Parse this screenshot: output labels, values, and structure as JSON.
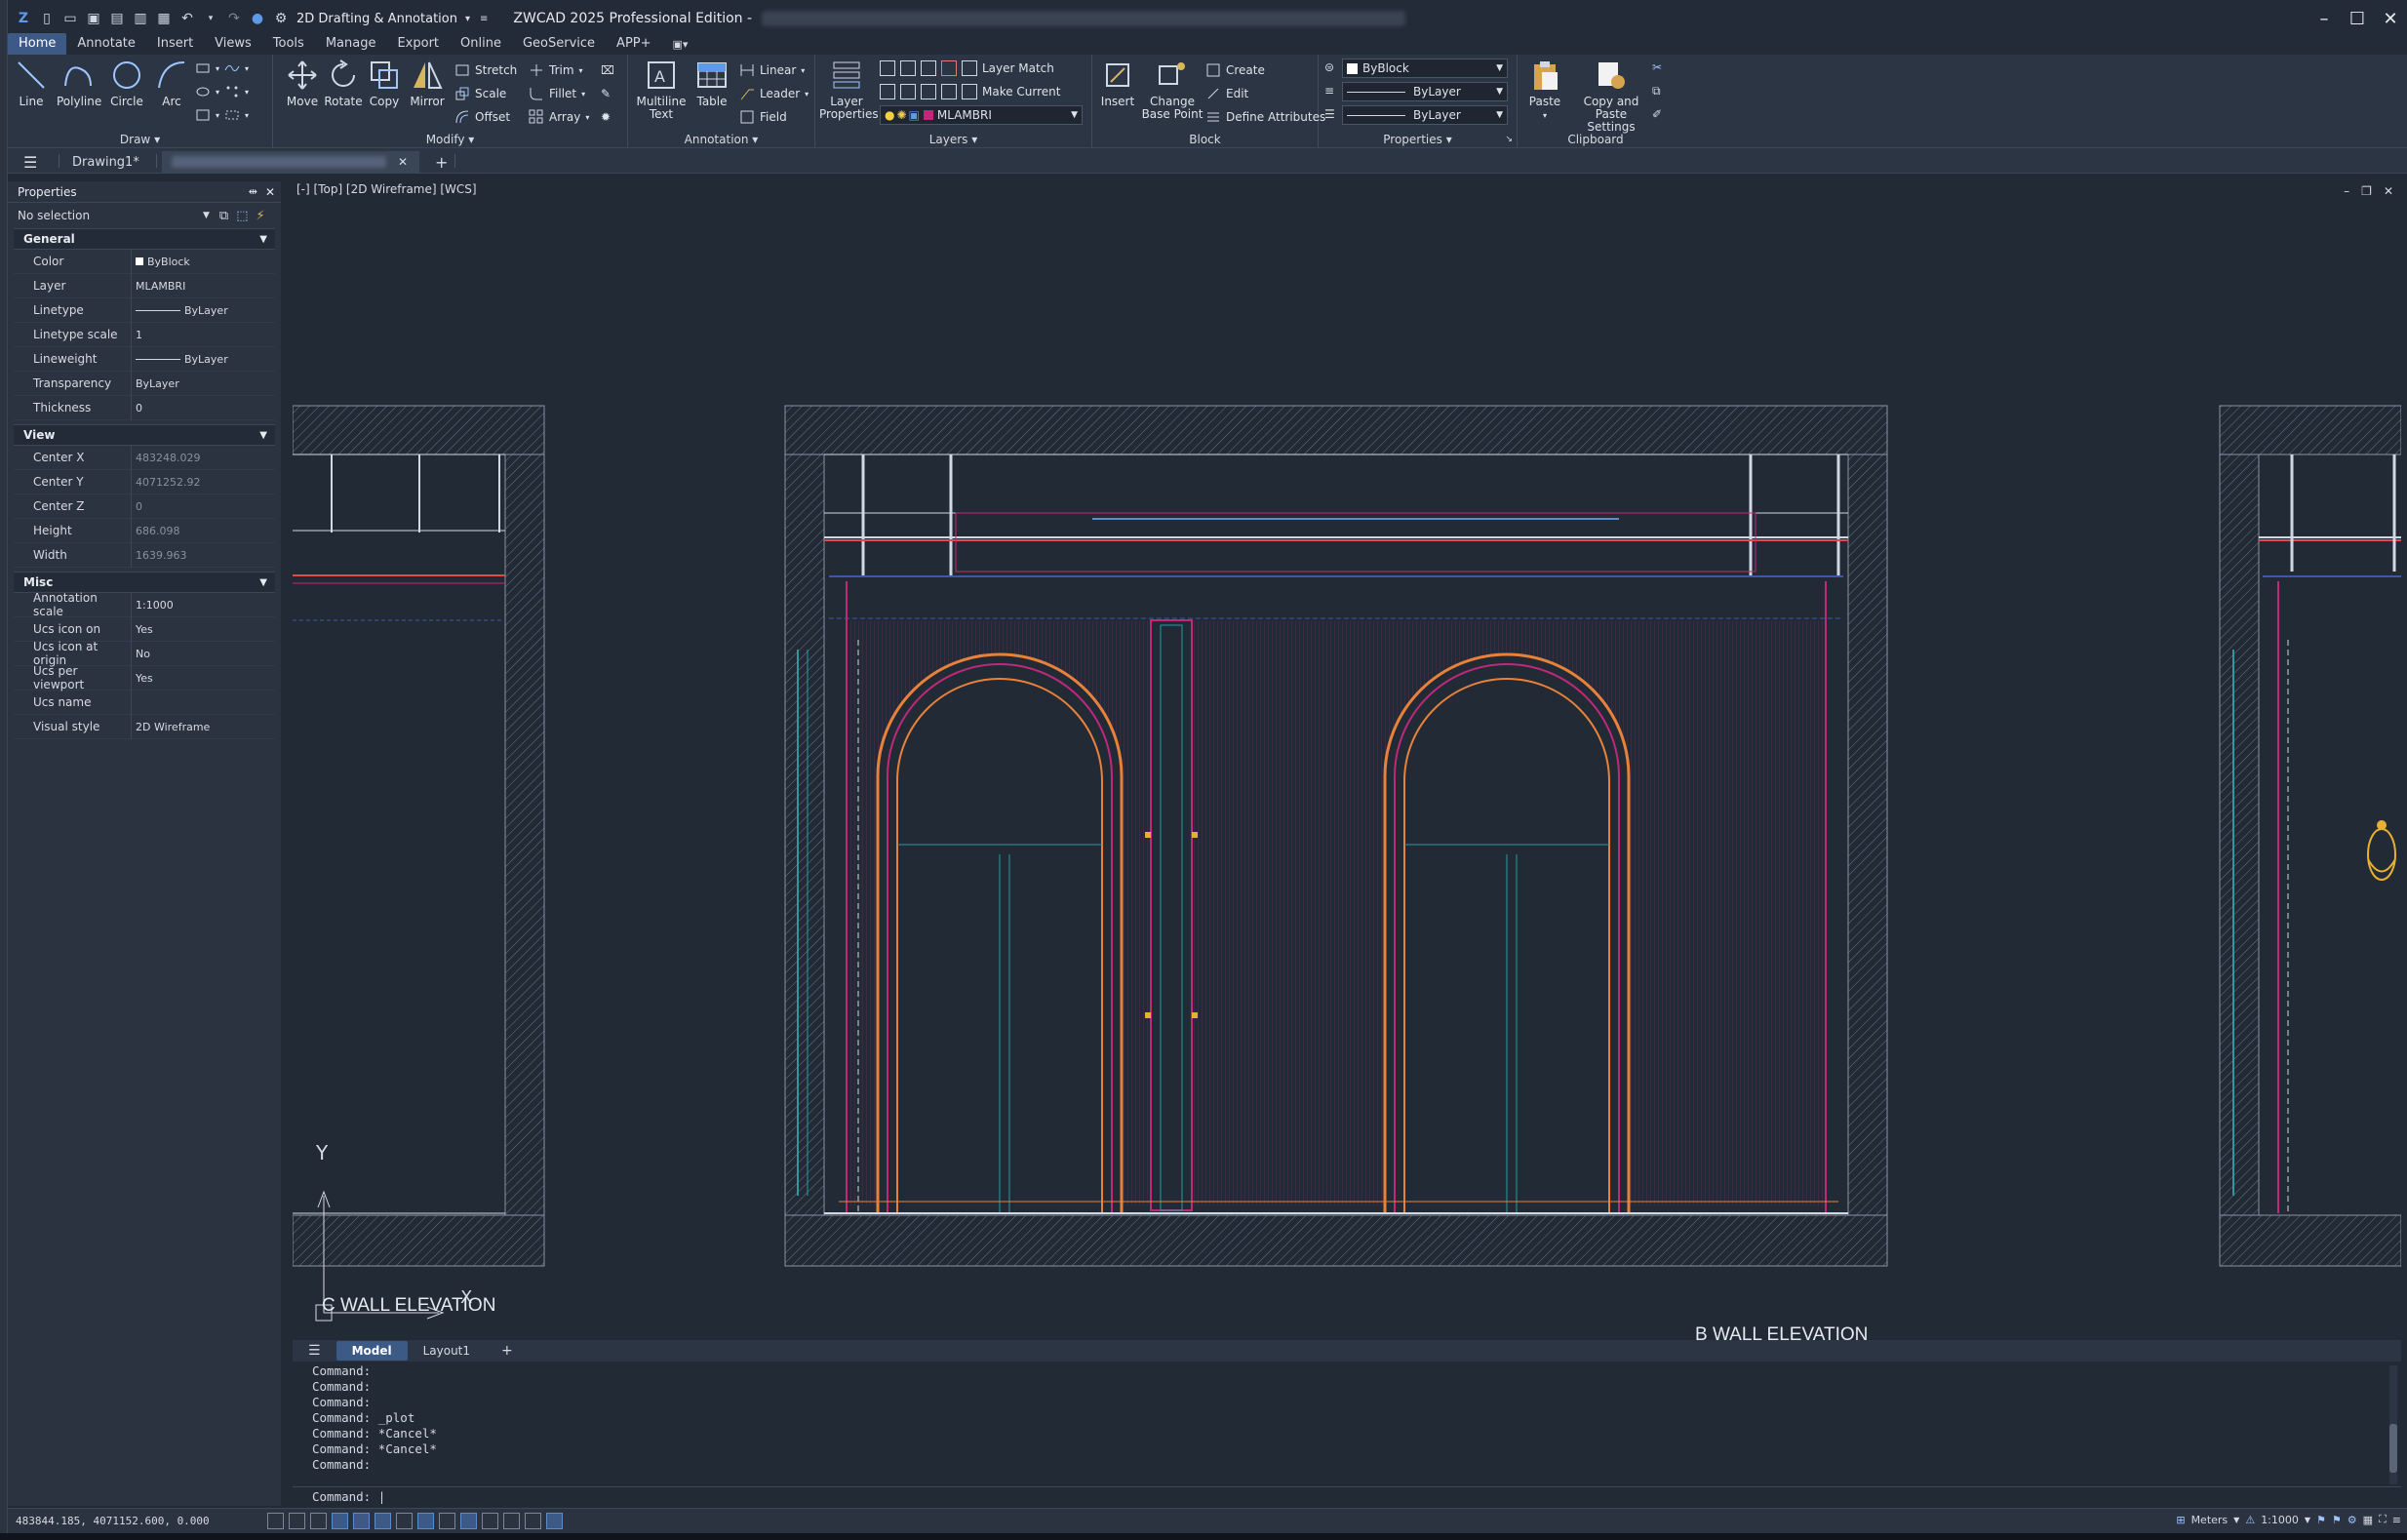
{
  "titlebar": {
    "workspace": "2D Drafting & Annotation",
    "app_title": "ZWCAD 2025 Professional Edition -"
  },
  "menu": [
    "Home",
    "Annotate",
    "Insert",
    "Views",
    "Tools",
    "Manage",
    "Export",
    "Online",
    "GeoService",
    "APP+"
  ],
  "ribbon": {
    "draw": {
      "label": "Draw",
      "line": "Line",
      "polyline": "Polyline",
      "circle": "Circle",
      "arc": "Arc"
    },
    "modify": {
      "label": "Modify",
      "move": "Move",
      "rotate": "Rotate",
      "copy": "Copy",
      "mirror": "Mirror",
      "stretch": "Stretch",
      "scale": "Scale",
      "offset": "Offset",
      "trim": "Trim",
      "fillet": "Fillet",
      "array": "Array"
    },
    "annotation": {
      "label": "Annotation",
      "multiline_text_1": "Multiline",
      "multiline_text_2": "Text",
      "table": "Table",
      "linear": "Linear",
      "leader": "Leader",
      "field": "Field"
    },
    "layers": {
      "label": "Layers",
      "layer_properties_1": "Layer",
      "layer_properties_2": "Properties",
      "layer_match": "Layer Match",
      "make_current": "Make Current",
      "current_layer": "MLAMBRI"
    },
    "block": {
      "label": "Block",
      "insert": "Insert",
      "change_base_1": "Change",
      "change_base_2": "Base Point",
      "create": "Create",
      "edit": "Edit",
      "define_attributes": "Define Attributes"
    },
    "properties": {
      "label": "Properties",
      "color": "ByBlock",
      "linetype": "ByLayer",
      "lineweight": "ByLayer"
    },
    "clipboard": {
      "label": "Clipboard",
      "paste": "Paste",
      "copy_paste_1": "Copy and Paste",
      "copy_paste_2": "Settings"
    }
  },
  "tabs": {
    "drawing1": "Drawing1*"
  },
  "properties_panel": {
    "title": "Properties",
    "selection": "No selection",
    "general_label": "General",
    "general": [
      {
        "k": "Color",
        "v": "ByBlock"
      },
      {
        "k": "Layer",
        "v": "MLAMBRI"
      },
      {
        "k": "Linetype",
        "v": "ByLayer"
      },
      {
        "k": "Linetype scale",
        "v": "1"
      },
      {
        "k": "Lineweight",
        "v": "ByLayer"
      },
      {
        "k": "Transparency",
        "v": "ByLayer"
      },
      {
        "k": "Thickness",
        "v": "0"
      }
    ],
    "view_label": "View",
    "view": [
      {
        "k": "Center X",
        "v": "483248.029"
      },
      {
        "k": "Center Y",
        "v": "4071252.92"
      },
      {
        "k": "Center Z",
        "v": "0"
      },
      {
        "k": "Height",
        "v": "686.098"
      },
      {
        "k": "Width",
        "v": "1639.963"
      }
    ],
    "misc_label": "Misc",
    "misc": [
      {
        "k": "Annotation scale",
        "v": "1:1000"
      },
      {
        "k": "Ucs icon on",
        "v": "Yes"
      },
      {
        "k": "Ucs icon at origin",
        "v": "No"
      },
      {
        "k": "Ucs per viewport",
        "v": "Yes"
      },
      {
        "k": "Ucs name",
        "v": ""
      },
      {
        "k": "Visual style",
        "v": "2D Wireframe"
      }
    ]
  },
  "viewport": {
    "label": "[-] [Top] [2D Wireframe] [WCS]",
    "c_wall": "C WALL ELEVATION",
    "b_wall": "B WALL ELEVATION",
    "ucs_y": "Y",
    "ucs_x": "X"
  },
  "layouts": {
    "model": "Model",
    "layout1": "Layout1"
  },
  "command_history": [
    "Command:",
    "Command:",
    "Command:",
    "Command: _plot",
    "Command: *Cancel*",
    "Command: *Cancel*",
    "Command:"
  ],
  "command_prompt": "Command:",
  "status": {
    "coords": "483844.185, 4071152.600, 0.000",
    "units": "Meters",
    "scale": "1:1000"
  }
}
